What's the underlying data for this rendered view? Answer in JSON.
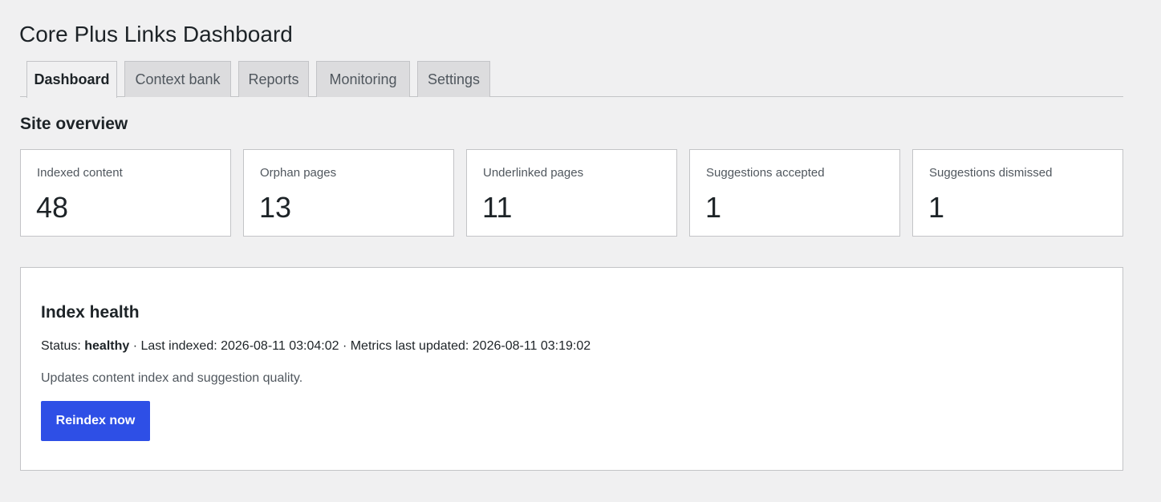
{
  "header": {
    "title": "Core Plus Links Dashboard"
  },
  "tabs": [
    {
      "label": "Dashboard",
      "active": true
    },
    {
      "label": "Context bank",
      "active": false
    },
    {
      "label": "Reports",
      "active": false
    },
    {
      "label": "Monitoring",
      "active": false
    },
    {
      "label": "Settings",
      "active": false
    }
  ],
  "overview": {
    "title": "Site overview",
    "cards": [
      {
        "label": "Indexed content",
        "value": "48"
      },
      {
        "label": "Orphan pages",
        "value": "13"
      },
      {
        "label": "Underlinked pages",
        "value": "11"
      },
      {
        "label": "Suggestions accepted",
        "value": "1"
      },
      {
        "label": "Suggestions dismissed",
        "value": "1"
      }
    ]
  },
  "health": {
    "title": "Index health",
    "status_prefix": "Status: ",
    "status_value": "healthy",
    "status_rest": " · Last indexed: 2026-08-11 03:04:02 · Metrics last updated: 2026-08-11 03:19:02",
    "description": "Updates content index and suggestion quality.",
    "button_label": "Reindex now",
    "button_color": "#2e4fe6"
  }
}
